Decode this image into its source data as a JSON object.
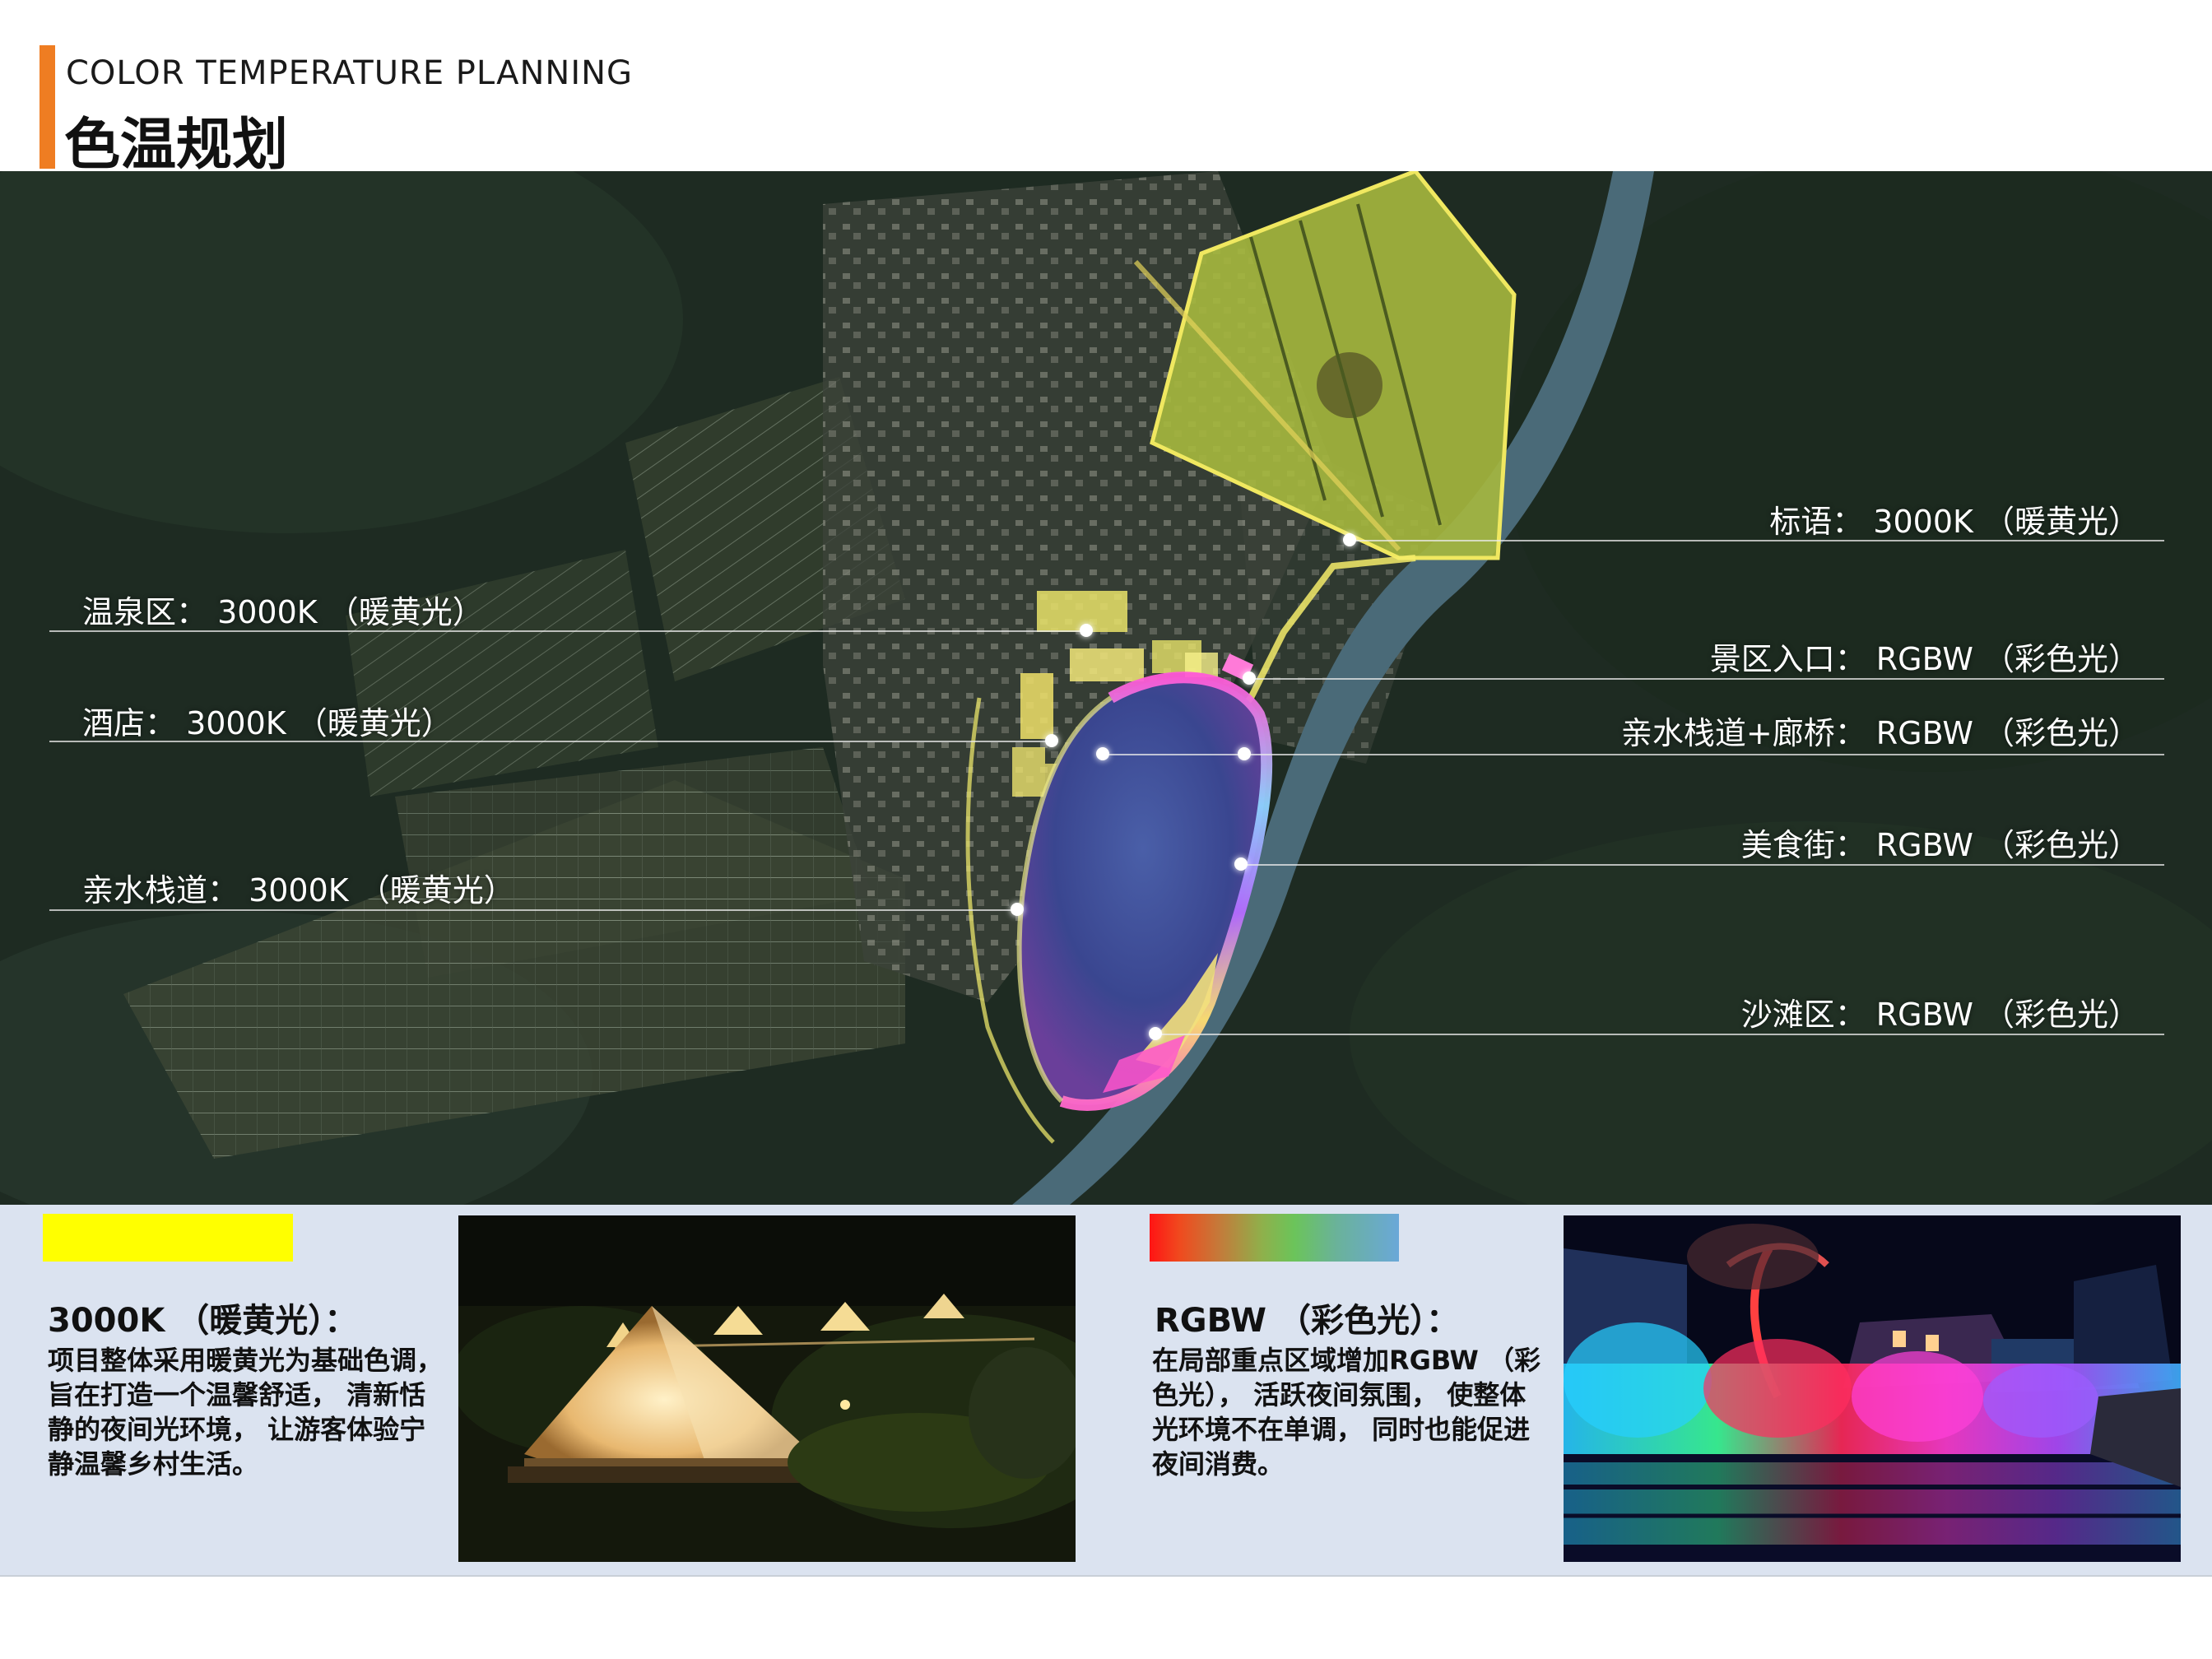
{
  "header": {
    "title_en": "COLOR TEMPERATURE PLANNING",
    "title_zh": "色温规划"
  },
  "colors": {
    "accent": "#ef7d22",
    "warm_swatch": "#ffff00",
    "panel_bg": "#dbe3f0"
  },
  "map": {
    "labels_left": [
      {
        "text": "温泉区： 3000K （暖黄光）"
      },
      {
        "text": "酒店： 3000K （暖黄光）"
      },
      {
        "text": "亲水栈道： 3000K （暖黄光）"
      }
    ],
    "labels_right": [
      {
        "text": "标语： 3000K （暖黄光）"
      },
      {
        "text": "景区入口： RGBW （彩色光）"
      },
      {
        "text": "亲水栈道+廊桥： RGBW （彩色光）"
      },
      {
        "text": "美食街： RGBW （彩色光）"
      },
      {
        "text": "沙滩区： RGBW （彩色光）"
      }
    ]
  },
  "legend": {
    "warm": {
      "title": "3000K （暖黄光）：",
      "description": "项目整体采用暖黄光为基础色调， 旨在打造一个温馨舒适， 清新恬静的夜间光环境， 让游客体验宁静温馨乡村生活。",
      "photo": "tent-campsite-night-photo"
    },
    "rgbw": {
      "title": "RGBW （彩色光）：",
      "description": "在局部重点区域增加RGBW （彩色光）， 活跃夜间氛围， 使整体光环境不在单调， 同时也能促进夜间消费。",
      "photo": "colorful-waterfront-night-photo"
    }
  }
}
